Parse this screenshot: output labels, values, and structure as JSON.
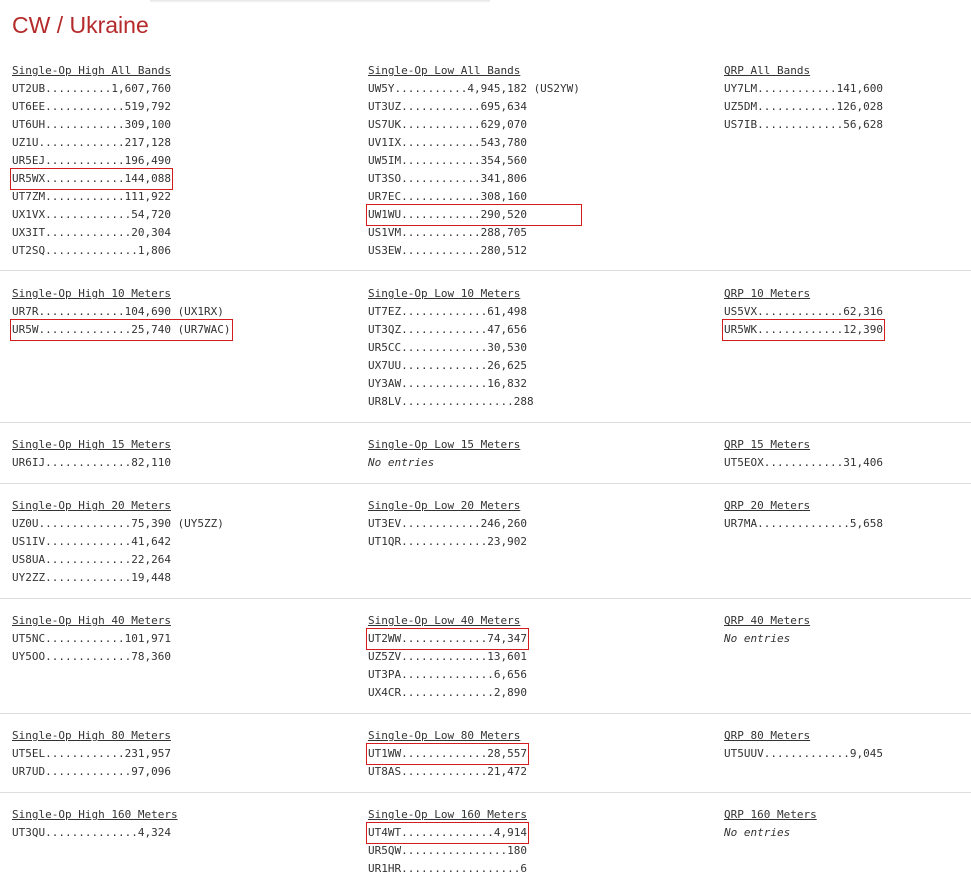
{
  "page_title": "CW / Ukraine",
  "highlight_color": "#d21d1d",
  "sections": [
    {
      "columns": [
        {
          "heading": "Single-Op High All Bands",
          "rows": [
            {
              "text": "UT2UB..........1,607,760"
            },
            {
              "text": "UT6EE............519,792"
            },
            {
              "text": "UT6UH............309,100"
            },
            {
              "text": "UZ1U.............217,128"
            },
            {
              "text": "UR5EJ............196,490"
            },
            {
              "text": "UR5WX............144,088",
              "highlight": true
            },
            {
              "text": "UT7ZM............111,922"
            },
            {
              "text": "UX1VX.............54,720"
            },
            {
              "text": "UX3IT.............20,304"
            },
            {
              "text": "UT2SQ..............1,806"
            }
          ]
        },
        {
          "heading": "Single-Op Low All Bands",
          "rows": [
            {
              "text": "UW5Y...........4,945,182 (US2YW)"
            },
            {
              "text": "UT3UZ............695,634"
            },
            {
              "text": "US7UK............629,070"
            },
            {
              "text": "UV1IX............543,780"
            },
            {
              "text": "UW5IM............354,560"
            },
            {
              "text": "UT3SO............341,806"
            },
            {
              "text": "UR7EC............308,160"
            },
            {
              "text": "UW1WU............290,520",
              "highlight": true
            },
            {
              "text": "US1VM............288,705"
            },
            {
              "text": "US3EW............280,512"
            }
          ]
        },
        {
          "heading": "QRP All Bands",
          "rows": [
            {
              "text": "UY7LM............141,600"
            },
            {
              "text": "UZ5DM............126,028"
            },
            {
              "text": "US7IB.............56,628"
            }
          ]
        }
      ]
    },
    {
      "columns": [
        {
          "heading": "Single-Op High 10 Meters",
          "rows": [
            {
              "text": "UR7R.............104,690 (UX1RX)"
            },
            {
              "text": "UR5W..............25,740 (UR7WAC)",
              "highlight": true
            }
          ]
        },
        {
          "heading": "Single-Op Low 10 Meters",
          "rows": [
            {
              "text": "UT7EZ.............61,498"
            },
            {
              "text": "UT3QZ.............47,656"
            },
            {
              "text": "UR5CC.............30,530"
            },
            {
              "text": "UX7UU.............26,625"
            },
            {
              "text": "UY3AW.............16,832"
            },
            {
              "text": "UR8LV.................288"
            }
          ]
        },
        {
          "heading": "QRP 10 Meters",
          "rows": [
            {
              "text": "US5VX.............62,316"
            },
            {
              "text": "UR5WK.............12,390",
              "highlight": true
            }
          ]
        }
      ]
    },
    {
      "columns": [
        {
          "heading": "Single-Op High 15 Meters",
          "rows": [
            {
              "text": "UR6IJ.............82,110"
            }
          ]
        },
        {
          "heading": "Single-Op Low 15 Meters",
          "empty": "No entries",
          "rows": []
        },
        {
          "heading": "QRP 15 Meters",
          "rows": [
            {
              "text": "UT5EOX............31,406"
            }
          ]
        }
      ]
    },
    {
      "columns": [
        {
          "heading": "Single-Op High 20 Meters",
          "rows": [
            {
              "text": "UZ0U..............75,390 (UY5ZZ)"
            },
            {
              "text": "US1IV.............41,642"
            },
            {
              "text": "US8UA.............22,264"
            },
            {
              "text": "UY2ZZ.............19,448"
            }
          ]
        },
        {
          "heading": "Single-Op Low 20 Meters",
          "rows": [
            {
              "text": "UT3EV............246,260"
            },
            {
              "text": "UT1QR.............23,902"
            }
          ]
        },
        {
          "heading": "QRP 20 Meters",
          "rows": [
            {
              "text": "UR7MA..............5,658"
            }
          ]
        }
      ]
    },
    {
      "columns": [
        {
          "heading": "Single-Op High 40 Meters",
          "rows": [
            {
              "text": "UT5NC............101,971"
            },
            {
              "text": "UY5OO.............78,360"
            }
          ]
        },
        {
          "heading": "Single-Op Low 40 Meters",
          "rows": [
            {
              "text": "UT2WW.............74,347",
              "highlight": true
            },
            {
              "text": "UZ5ZV.............13,601"
            },
            {
              "text": "UT3PA..............6,656"
            },
            {
              "text": "UX4CR..............2,890"
            }
          ]
        },
        {
          "heading": "QRP 40 Meters",
          "empty": "No entries",
          "rows": []
        }
      ]
    },
    {
      "columns": [
        {
          "heading": "Single-Op High 80 Meters",
          "rows": [
            {
              "text": "UT5EL............231,957"
            },
            {
              "text": "UR7UD.............97,096"
            }
          ]
        },
        {
          "heading": "Single-Op Low 80 Meters",
          "rows": [
            {
              "text": "UT1WW.............28,557",
              "highlight": true
            },
            {
              "text": "UT8AS.............21,472"
            }
          ]
        },
        {
          "heading": "QRP 80 Meters",
          "rows": [
            {
              "text": "UT5UUV.............9,045"
            }
          ]
        }
      ]
    },
    {
      "columns": [
        {
          "heading": "Single-Op High 160 Meters",
          "rows": [
            {
              "text": "UT3QU..............4,324"
            }
          ]
        },
        {
          "heading": "Single-Op Low 160 Meters",
          "rows": [
            {
              "text": "UT4WT..............4,914",
              "highlight": true
            },
            {
              "text": "UR5QW................180"
            },
            {
              "text": "UR1HR..................6"
            }
          ]
        },
        {
          "heading": "QRP 160 Meters",
          "empty": "No entries",
          "rows": []
        }
      ]
    }
  ]
}
